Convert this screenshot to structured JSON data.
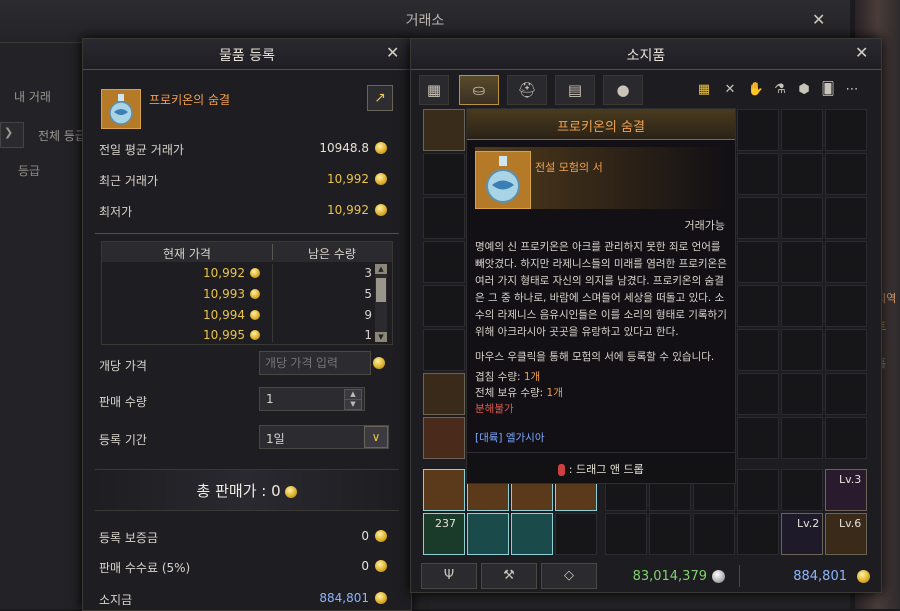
{
  "background": {
    "title": "거래소",
    "tab_my_trade": "내 거래",
    "filter_text": "전체 등급",
    "grade_header": "등급",
    "right_text_1": "지역",
    "right_text_2": "트",
    "right_text_3": "흘"
  },
  "registration": {
    "title": "물품 등록",
    "item_name": "프로키온의 숨결",
    "rows": [
      {
        "label": "전일 평균 거래가",
        "value": "10948.8"
      },
      {
        "label": "최근 거래가",
        "value": "10,992"
      },
      {
        "label": "최저가",
        "value": "10,992"
      }
    ],
    "table_headers": {
      "price": "현재 가격",
      "qty": "남은 수량"
    },
    "listings": [
      {
        "price": "10,992",
        "qty": "3"
      },
      {
        "price": "10,993",
        "qty": "5"
      },
      {
        "price": "10,994",
        "qty": "9"
      },
      {
        "price": "10,995",
        "qty": "1"
      }
    ],
    "unit_price_label": "개당 가격",
    "unit_price_placeholder": "개당 가격 입력",
    "quantity_label": "판매 수량",
    "quantity_value": "1",
    "period_label": "등록 기간",
    "period_value": "1일",
    "total_label": "총 판매가 : 0",
    "deposit_label": "등록 보증금",
    "deposit_value": "0",
    "fee_label": "판매 수수료 (5%)",
    "fee_value": "0",
    "holding_label": "소지금",
    "holding_value": "884,801"
  },
  "inventory": {
    "title": "소지품",
    "silver": "83,014,379",
    "gold": "884,801",
    "stack_count": "237",
    "lv_labels": [
      "Lv.3",
      "Lv.2",
      "Lv.6"
    ]
  },
  "tooltip": {
    "title": "프로키온의 숨결",
    "grade": "전설 모험의 서",
    "tradable": "거래가능",
    "description": "명예의 신 프로키온은 아크를 관리하지 못한 죄로 언어를 빼앗겼다. 하지만 라제니스들의 미래를 염려한 프로키온은 여러 가지 형태로 자신의 의지를 남겼다. 프로키온의 숨결은 그 중 하나로, 바람에 스며들어 세상을 떠돌고 있다. 소수의 라제니스 음유시인들은 이를 소리의 형태로 기록하기 위해 아크라시아 곳곳을 유랑하고 있다고 한다.",
    "use_text": "마우스 우클릭을 통해 모험의 서에 등록할 수 있습니다.",
    "stack_label": "겹침 수량: ",
    "stack_value": "1개",
    "owned_label": "전체 보유 수량: ",
    "owned_value": "1개",
    "no_disassemble": "분해불가",
    "region": "[대륙] 엘가시아",
    "drag_hint": ": 드래그 앤 드롭"
  }
}
